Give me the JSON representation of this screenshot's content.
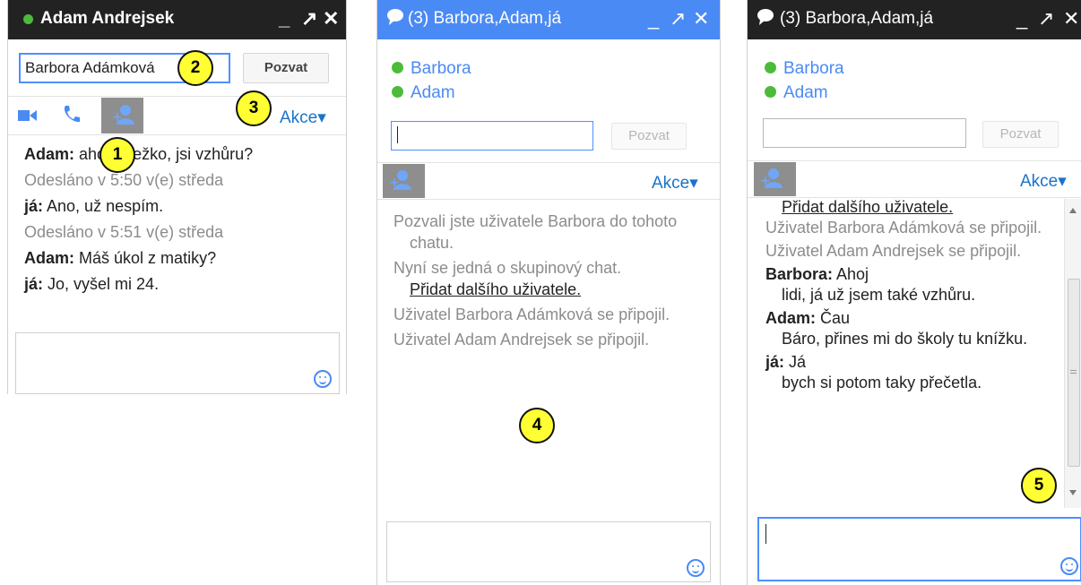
{
  "window1": {
    "title": "Adam Andrejsek",
    "minimize": "_",
    "popout": "↗",
    "close": "✕",
    "invite_value": "Barbora Adámková",
    "invite_button": "Pozvat",
    "toolbar_icons": [
      "video-icon",
      "phone-icon",
      "add-person-icon"
    ],
    "actions_label": "Akce▾",
    "messages": [
      {
        "sender": "Adam:",
        "text": "ahoj Anežko, jsi vzhůru?"
      },
      {
        "status": "Odesláno v 5:50 v(e) středa"
      },
      {
        "sender": "já:",
        "text": "Ano, už nespím."
      },
      {
        "status": "Odesláno v 5:51 v(e) středa"
      },
      {
        "sender": "Adam:",
        "text": "Máš úkol z matiky?"
      },
      {
        "sender": "já:",
        "text": "Jo, vyšel mi 24."
      }
    ]
  },
  "window2": {
    "title": "(3) Barbora,Adam,já",
    "minimize": "_",
    "popout": "↗",
    "close": "✕",
    "participants": [
      "Barbora",
      "Adam"
    ],
    "invite_value": "",
    "invite_button": "Pozvat",
    "actions_label": "Akce▾",
    "system_messages": [
      "Pozvali jste uživatele Barbora do tohoto chatu.",
      "Nyní se jedná o skupinový chat.",
      "Přidat dalšího uživatele.",
      "Uživatel Barbora Adámková se připojil.",
      "Uživatel Adam Andrejsek se připojil."
    ]
  },
  "window3": {
    "title": "(3) Barbora,Adam,já",
    "minimize": "_",
    "popout": "↗",
    "close": "✕",
    "participants": [
      "Barbora",
      "Adam"
    ],
    "invite_button": "Pozvat",
    "actions_label": "Akce▾",
    "add_user_link": "Přidat dalšího uživatele.",
    "system_messages": [
      "Uživatel Barbora Adámková se připojil.",
      "Uživatel Adam Andrejsek se připojil."
    ],
    "messages": [
      {
        "sender": "Barbora:",
        "first": "Ahoj",
        "rest": "lidi, já už jsem také vzhůru."
      },
      {
        "sender": "Adam:",
        "first": "Čau",
        "rest": "Báro, přines mi do školy tu knížku."
      },
      {
        "sender": "já:",
        "first": "Já",
        "rest": "bych si potom taky přečetla."
      }
    ]
  },
  "callouts": [
    "1",
    "2",
    "3",
    "4",
    "5"
  ],
  "colors": {
    "online": "#4dbb3a",
    "accent": "#4a8af4",
    "title_dark": "#222222",
    "callout": "#ffff33"
  }
}
